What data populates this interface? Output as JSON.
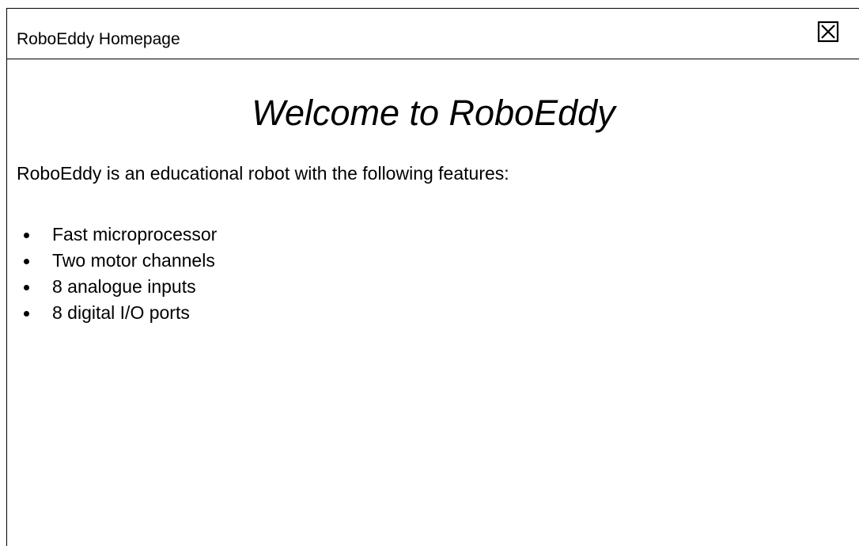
{
  "window": {
    "title": "RoboEddy Homepage",
    "close_icon": "close-box-icon"
  },
  "main": {
    "heading": "Welcome to RoboEddy",
    "intro": "RoboEddy is an educational robot with the following features:",
    "features": [
      "Fast microprocessor",
      "Two motor channels",
      "8 analogue inputs",
      "8 digital I/O ports"
    ]
  }
}
